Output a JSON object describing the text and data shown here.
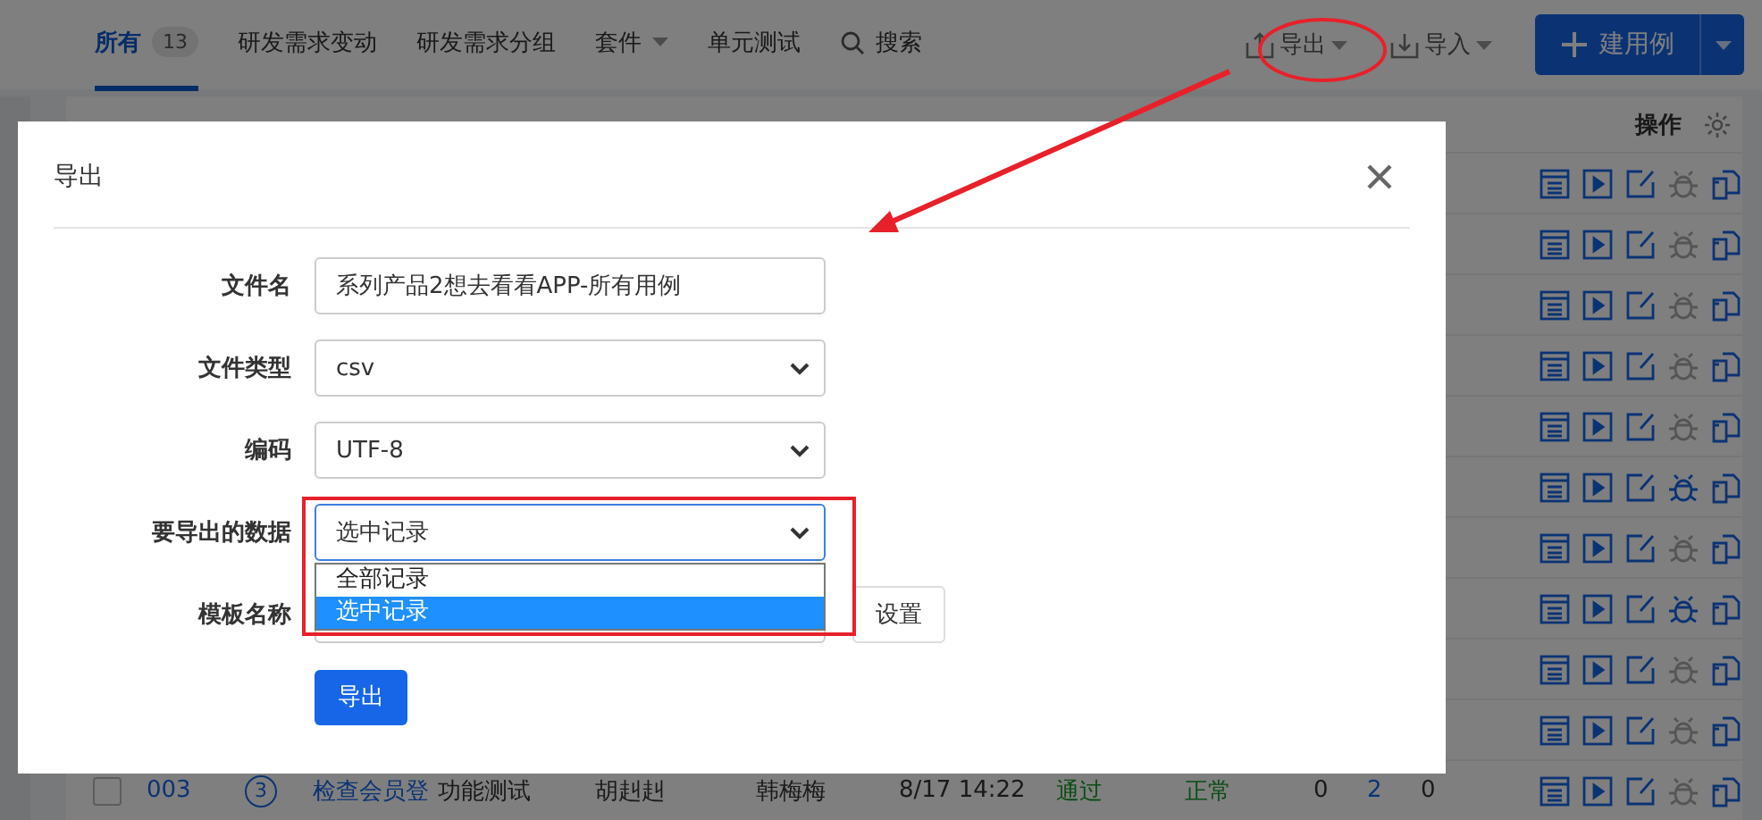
{
  "topbar": {
    "items": [
      {
        "kind": "tab",
        "label": "所有",
        "badge": "13",
        "selected": true
      },
      {
        "kind": "tab",
        "label": "研发需求变动",
        "selected": false
      },
      {
        "kind": "tab",
        "label": "研发需求分组",
        "selected": false
      },
      {
        "kind": "menu",
        "label": "套件"
      },
      {
        "kind": "tab",
        "label": "单元测试",
        "selected": false
      },
      {
        "kind": "search",
        "label": "搜索"
      }
    ],
    "actions": [
      {
        "kind": "export",
        "label": "导出"
      },
      {
        "kind": "import",
        "label": "导入"
      }
    ],
    "primary_button": "建用例"
  },
  "table": {
    "actions_header": "操作",
    "rows": [
      {
        "bug_active": false
      },
      {
        "bug_active": false
      },
      {
        "bug_active": false
      },
      {
        "bug_active": false
      },
      {
        "bug_active": false
      },
      {
        "bug_active": true
      },
      {
        "bug_active": false
      },
      {
        "bug_active": true
      },
      {
        "bug_active": false
      },
      {
        "bug_active": false
      },
      {
        "bug_active": false,
        "checked": false,
        "cells": {
          "id": "003",
          "priority": "3",
          "title": "检查会员登",
          "type": "功能测试",
          "creator": "胡赳赳",
          "executor": "韩梅梅",
          "time": "8/17 14:22",
          "result": "通过",
          "status": "正常",
          "b": "0",
          "r": "2",
          "s": "0"
        }
      }
    ]
  },
  "dialog": {
    "title": "导出",
    "fields": [
      {
        "kind": "text",
        "label": "文件名",
        "value": "系列产品2想去看看APP-所有用例"
      },
      {
        "kind": "select",
        "label": "文件类型",
        "value": "csv"
      },
      {
        "kind": "select",
        "label": "编码",
        "value": "UTF-8"
      },
      {
        "kind": "select",
        "label": "要导出的数据",
        "value": "选中记录",
        "expanded": true,
        "options": [
          {
            "label": "全部记录",
            "selected": false
          },
          {
            "label": "选中记录",
            "selected": true
          }
        ]
      },
      {
        "kind": "text_button",
        "label": "模板名称",
        "button": "设置"
      }
    ],
    "submit": "导出"
  }
}
